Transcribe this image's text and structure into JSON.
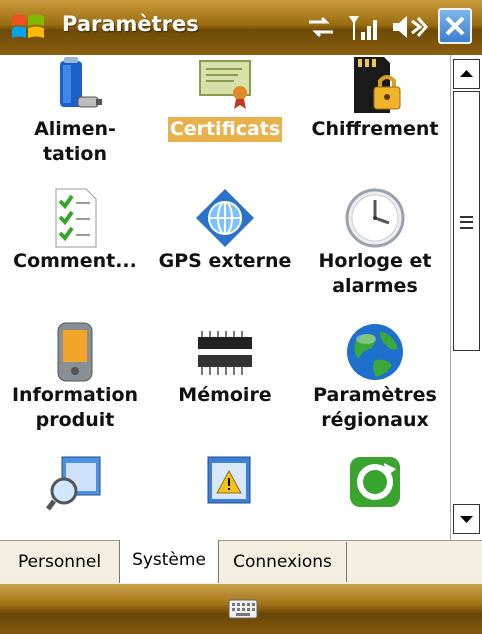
{
  "titlebar": {
    "title": "Paramètres",
    "icons": [
      "windows-start-icon",
      "sync-arrows-icon",
      "signal-icon",
      "speaker-icon",
      "close-icon"
    ]
  },
  "items": [
    {
      "label": "Alimen-\ntation",
      "icon": "battery-icon",
      "selected": false
    },
    {
      "label": "Certificats",
      "icon": "certificate-icon",
      "selected": true
    },
    {
      "label": "Chiffrement",
      "icon": "encryption-lock-icon",
      "selected": false
    },
    {
      "label": "Comment...",
      "icon": "checklist-icon",
      "selected": false
    },
    {
      "label": "GPS externe",
      "icon": "gps-globe-icon",
      "selected": false
    },
    {
      "label": "Horloge et\nalarmes",
      "icon": "clock-icon",
      "selected": false
    },
    {
      "label": "Information\nproduit",
      "icon": "device-icon",
      "selected": false
    },
    {
      "label": "Mémoire",
      "icon": "memory-chip-icon",
      "selected": false
    },
    {
      "label": "Paramètres\nrégionaux",
      "icon": "globe-icon",
      "selected": false
    },
    {
      "label": "",
      "icon": "search-window-icon",
      "selected": false
    },
    {
      "label": "",
      "icon": "warning-window-icon",
      "selected": false
    },
    {
      "label": "",
      "icon": "reset-icon",
      "selected": false
    }
  ],
  "tabs": [
    {
      "label": "Personnel",
      "active": false
    },
    {
      "label": "Système",
      "active": true
    },
    {
      "label": "Connexions",
      "active": false
    }
  ],
  "bottombar": {
    "icon": "keyboard-icon"
  },
  "colors": {
    "titlebar": "#9b6d12",
    "selection": "#e7b24c",
    "close_button": "#3c7fd0"
  }
}
